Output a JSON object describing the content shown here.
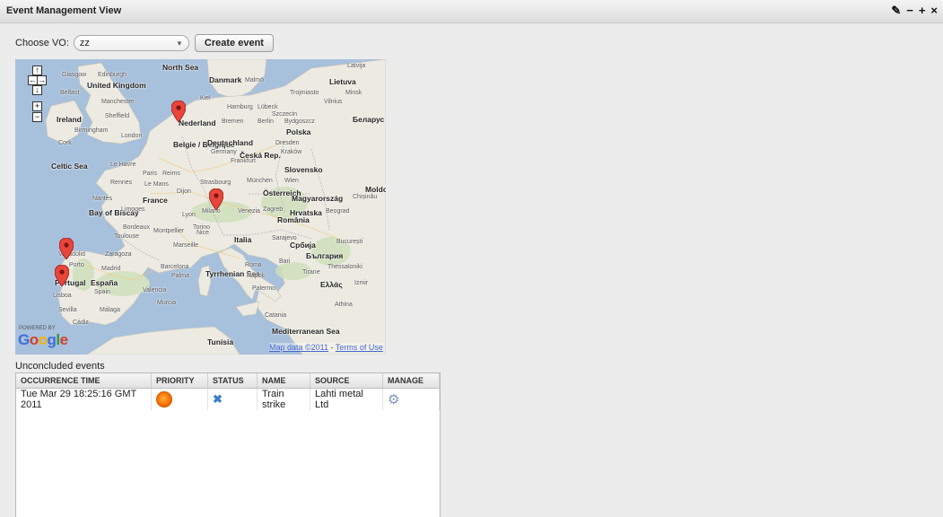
{
  "window": {
    "title": "Event Management View",
    "controls": [
      {
        "name": "wrench-icon",
        "glyph": "✎"
      },
      {
        "name": "minimize-icon",
        "glyph": "−"
      },
      {
        "name": "maximize-icon",
        "glyph": "+"
      },
      {
        "name": "close-icon",
        "glyph": "×"
      }
    ]
  },
  "vo": {
    "label": "Choose VO:",
    "selected": "zz",
    "create_button": "Create event"
  },
  "map": {
    "labels": [
      {
        "text": "North Sea",
        "bold": true
      },
      {
        "text": "Glasgow"
      },
      {
        "text": "Edinburgh"
      },
      {
        "text": "United Kingdom",
        "bold": true
      },
      {
        "text": "Belfast"
      },
      {
        "text": "Manchester"
      },
      {
        "text": "Sheffield"
      },
      {
        "text": "Ireland",
        "bold": true
      },
      {
        "text": "Birmingham"
      },
      {
        "text": "London"
      },
      {
        "text": "Cork"
      },
      {
        "text": "Danmark",
        "bold": true
      },
      {
        "text": "Malmö"
      },
      {
        "text": "Lietuva",
        "bold": true
      },
      {
        "text": "Latvija"
      },
      {
        "text": "Trojmiasto"
      },
      {
        "text": "Minsk"
      },
      {
        "text": "Vilnius"
      },
      {
        "text": "Kiel"
      },
      {
        "text": "Hamburg"
      },
      {
        "text": "Lübeck"
      },
      {
        "text": "Szczecin"
      },
      {
        "text": "Nederland",
        "bold": true
      },
      {
        "text": "Bremen"
      },
      {
        "text": "Berlin"
      },
      {
        "text": "Bydgoszcz"
      },
      {
        "text": "Беларус",
        "bold": true
      },
      {
        "text": "Polska",
        "bold": true
      },
      {
        "text": "Belgie / Belgique",
        "bold": true
      },
      {
        "text": "Deutschland",
        "bold": true
      },
      {
        "text": "Dresden"
      },
      {
        "text": "Germany"
      },
      {
        "text": "Frankfurt"
      },
      {
        "text": "Česká Rep.",
        "bold": true
      },
      {
        "text": "Kraków"
      },
      {
        "text": "Celtic Sea",
        "bold": true
      },
      {
        "text": "Le Havre"
      },
      {
        "text": "Paris"
      },
      {
        "text": "Reims"
      },
      {
        "text": "Rennes"
      },
      {
        "text": "Le Mans"
      },
      {
        "text": "Strasbourg"
      },
      {
        "text": "München"
      },
      {
        "text": "Wien"
      },
      {
        "text": "Slovensko",
        "bold": true
      },
      {
        "text": "Dijon"
      },
      {
        "text": "Österreich",
        "bold": true
      },
      {
        "text": "France",
        "bold": true
      },
      {
        "text": "Nantes"
      },
      {
        "text": "Magyarország",
        "bold": true
      },
      {
        "text": "Moldova",
        "bold": true
      },
      {
        "text": "Chișinău"
      },
      {
        "text": "Bay of Biscay",
        "bold": true
      },
      {
        "text": "Limoges"
      },
      {
        "text": "Lyon"
      },
      {
        "text": "Milano"
      },
      {
        "text": "Venezia"
      },
      {
        "text": "Zagreb"
      },
      {
        "text": "Hrvatska",
        "bold": true
      },
      {
        "text": "Beograd"
      },
      {
        "text": "România",
        "bold": true
      },
      {
        "text": "Bordeaux"
      },
      {
        "text": "Torino"
      },
      {
        "text": "Toulouse"
      },
      {
        "text": "Montpellier"
      },
      {
        "text": "Nice"
      },
      {
        "text": "Marseille"
      },
      {
        "text": "Italia",
        "bold": true
      },
      {
        "text": "Sarajevo"
      },
      {
        "text": "Србија",
        "bold": true
      },
      {
        "text": "București"
      },
      {
        "text": "България",
        "bold": true
      },
      {
        "text": "Valladolid"
      },
      {
        "text": "Zaragoza"
      },
      {
        "text": "Porto"
      },
      {
        "text": "Madrid"
      },
      {
        "text": "Barcelona"
      },
      {
        "text": "Roma"
      },
      {
        "text": "Bari"
      },
      {
        "text": "Tirane"
      },
      {
        "text": "Thessaloniki"
      },
      {
        "text": "Portugal",
        "bold": true
      },
      {
        "text": "España",
        "bold": true
      },
      {
        "text": "Palma"
      },
      {
        "text": "Valencia"
      },
      {
        "text": "Spain"
      },
      {
        "text": "Tyrrhenian Sea",
        "bold": true
      },
      {
        "text": "Napoli"
      },
      {
        "text": "Ελλάς",
        "bold": true
      },
      {
        "text": "Lisboa"
      },
      {
        "text": "Murcia"
      },
      {
        "text": "Palermo"
      },
      {
        "text": "Sevilla"
      },
      {
        "text": "Málaga"
      },
      {
        "text": "Cádiz"
      },
      {
        "text": "Catania"
      },
      {
        "text": "Athina"
      },
      {
        "text": "Izmir"
      },
      {
        "text": "Mediterranean Sea",
        "bold": true
      },
      {
        "text": "Tunisia",
        "bold": true
      }
    ],
    "powered_by": "POWERED BY",
    "logo": "Google",
    "attribution": "Map data ©2011",
    "terms": "Terms of Use"
  },
  "events": {
    "title": "Unconcluded events",
    "columns": [
      "OCCURRENCE TIME",
      "PRIORITY",
      "STATUS",
      "NAME",
      "SOURCE",
      "MANAGE"
    ],
    "rows": [
      {
        "time": "Tue Mar 29 18:25:16 GMT 2011",
        "priority": "high",
        "status": "x-icon",
        "name": "Train strike",
        "source": "Lahti metal Ltd",
        "manage": "gear-icon"
      }
    ]
  },
  "colors": {
    "sea": "#a7c0dc",
    "land": "#eceae1",
    "pin": "#e8453c",
    "google_blue": "#3c6fd8",
    "google_red": "#d6402d",
    "google_yellow": "#f2b300",
    "google_green": "#2f9a3b"
  }
}
